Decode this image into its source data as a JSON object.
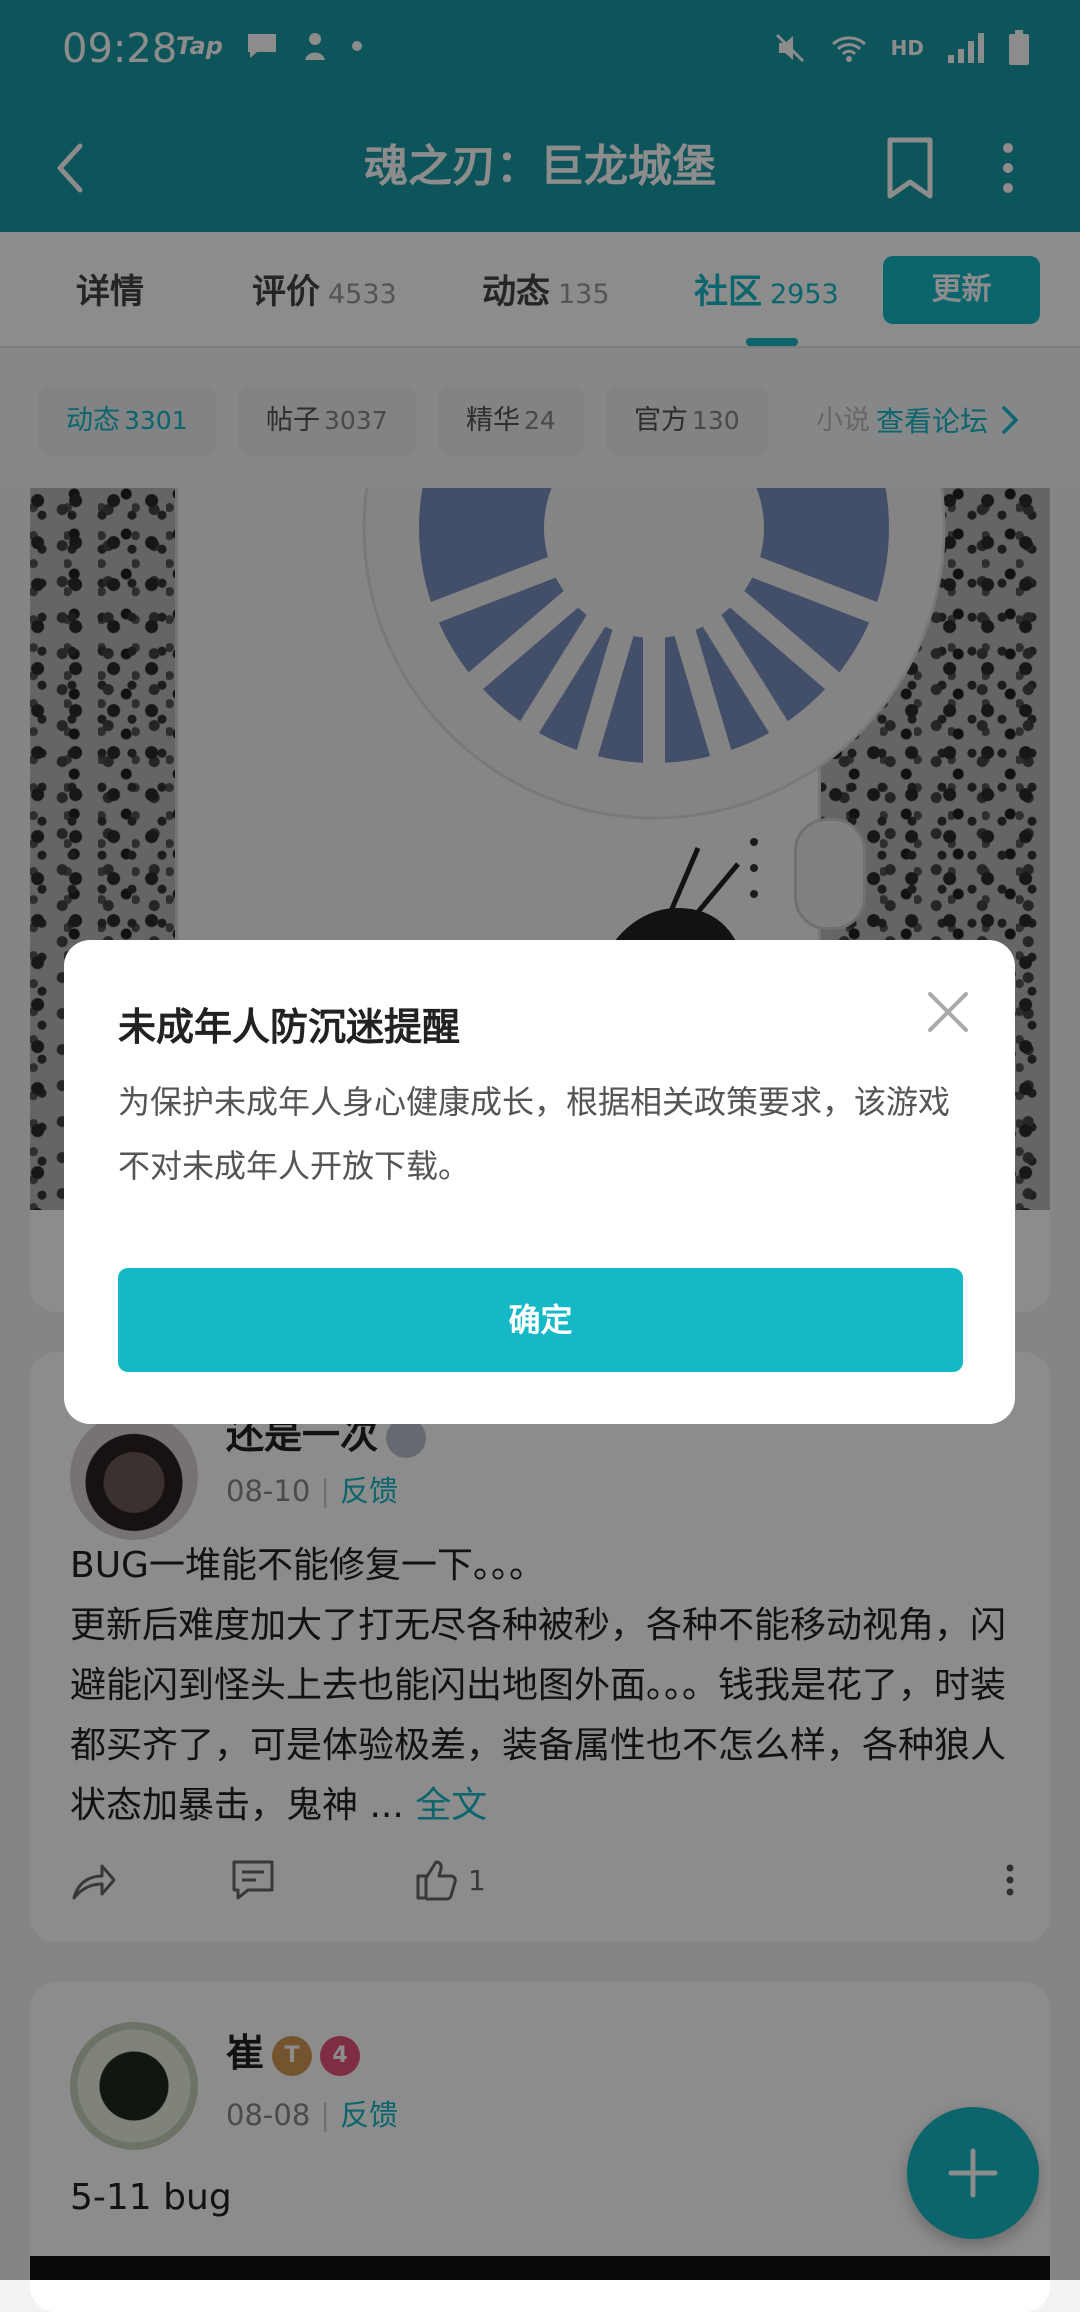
{
  "status_bar": {
    "time": "09:28",
    "tap_label": "Tap",
    "network": "HD"
  },
  "app_bar": {
    "title": "魂之刃：巨龙城堡"
  },
  "tabs": [
    {
      "label": "详情",
      "count": ""
    },
    {
      "label": "评价",
      "count": "4533"
    },
    {
      "label": "动态",
      "count": "135"
    },
    {
      "label": "社区",
      "count": "2953"
    }
  ],
  "update_button": "更新",
  "chips": [
    {
      "label": "动态",
      "count": "3301"
    },
    {
      "label": "帖子",
      "count": "3037"
    },
    {
      "label": "精华",
      "count": "24"
    },
    {
      "label": "官方",
      "count": "130"
    }
  ],
  "chip_partial": "小说",
  "forum_link": "查看论坛",
  "posts": [
    {
      "user": "还是一次",
      "date": "08-10",
      "tag": "反馈",
      "body": "BUG一堆能不能修复一下。。。\n更新后难度加大了打无尽各种被秒，各种不能移动视角，闪避能闪到怪头上去也能闪出地图外面。。。钱我是花了，时装都买齐了，可是体验极差，装备属性也不怎么样，各种狼人状态加暴击，鬼神 ... ",
      "more": "全文",
      "likes": "1"
    },
    {
      "user": "崔",
      "badge1": "T",
      "badge2": "4",
      "date": "08-08",
      "tag": "反馈",
      "body": "5-11  bug"
    }
  ],
  "dialog": {
    "title": "未成年人防沉迷提醒",
    "message": "为保护未成年人身心健康成长，根据相关政策要求，该游戏不对未成年人开放下载。",
    "confirm": "确定"
  },
  "colors": {
    "accent": "#15b9c6",
    "header": "#1a9aa6"
  }
}
